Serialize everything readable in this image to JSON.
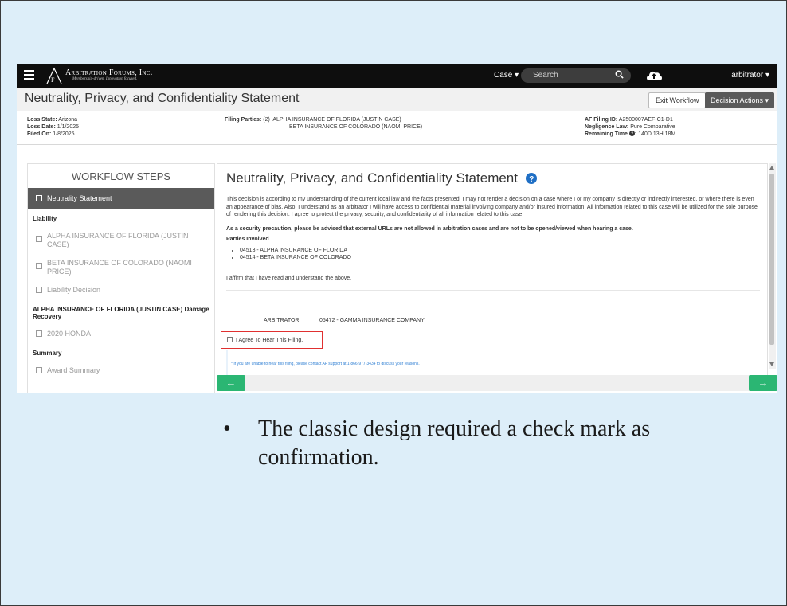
{
  "navbar": {
    "brand_name": "Arbitration Forums, Inc.",
    "brand_tagline": "Membership-driven. Innovation focused.",
    "case_menu": "Case ▾",
    "search_placeholder": "Search",
    "user_menu": "arbitrator ▾"
  },
  "header": {
    "title": "Neutrality, Privacy, and Confidentiality Statement",
    "exit_button": "Exit Workflow",
    "decision_button": "Decision Actions ▾"
  },
  "info": {
    "loss_state_label": "Loss State:",
    "loss_state": "Arizona",
    "loss_date_label": "Loss Date:",
    "loss_date": "1/1/2025",
    "filed_on_label": "Filed On:",
    "filed_on": "1/8/2025",
    "filing_parties_label": "Filing Parties:",
    "filing_parties_count": "(2)",
    "party1": "ALPHA INSURANCE OF FLORIDA (JUSTIN CASE)",
    "party2": "BETA INSURANCE OF COLORADO (NAOMI PRICE)",
    "filing_id_label": "AF Filing ID:",
    "filing_id": "A2500007AEF-C1-D1",
    "negligence_label": "Negligence Law:",
    "negligence": "Pure Comparative",
    "remaining_label": "Remaining Time",
    "remaining": "140D 13H 18M"
  },
  "workflow": {
    "title": "WORKFLOW STEPS",
    "active_step": "Neutrality Statement",
    "liability_heading": "Liability",
    "liability_items": [
      "ALPHA INSURANCE OF FLORIDA (JUSTIN CASE)",
      "BETA INSURANCE OF COLORADO (NAOMI PRICE)",
      "Liability Decision"
    ],
    "damage_heading": "ALPHA INSURANCE OF FLORIDA (JUSTIN CASE) Damage Recovery",
    "damage_items": [
      "2020 HONDA"
    ],
    "summary_heading": "Summary",
    "summary_items": [
      "Award Summary"
    ]
  },
  "statement": {
    "title": "Neutrality, Privacy, and Confidentiality Statement",
    "paragraph": "This decision is according to my understanding of the current local law and the facts presented. I may not render a decision on a case where I or my company is directly or indirectly interested, or where there is even an appearance of bias. Also, I understand as an arbitrator I will have access to confidential material involving company and/or insured information. All information related to this case will be utilized for the sole purpose of rendering this decision. I agree to protect the privacy, security, and confidentiality of all information related to this case.",
    "security_note": "As a security precaution, please be advised that external URLs are not allowed in arbitration cases and are not to be opened/viewed when hearing a case.",
    "parties_heading": "Parties Involved",
    "parties": [
      "04513 - ALPHA INSURANCE OF FLORIDA",
      "04514 - BETA INSURANCE OF COLORADO"
    ],
    "affirm": "I affirm that I have read and understand the above.",
    "arbitrator_role": "ARBITRATOR",
    "arbitrator_company": "05472 - GAMMA INSURANCE COMPANY",
    "agree_label": "I Agree To Hear This Filing.",
    "support_note": "* If you are unable to hear this filing, please contact AF support at 1-866-977-3434 to discuss your reasons."
  },
  "nav": {
    "prev": "←",
    "next": "→"
  },
  "caption": {
    "bullet": "•",
    "text": "The classic design required a check mark as confirmation."
  },
  "colors": {
    "slide_background": "#ddeef9",
    "navbar": "#0e0e0e",
    "active_step": "#5a5a5a",
    "nav_button": "#2bb673",
    "highlight_border": "#e03030",
    "link_blue": "#2f7fd3"
  },
  "icons": [
    "hamburger-icon",
    "search-icon",
    "cloud-upload-icon",
    "help-icon",
    "arrow-left-icon",
    "arrow-right-icon"
  ]
}
